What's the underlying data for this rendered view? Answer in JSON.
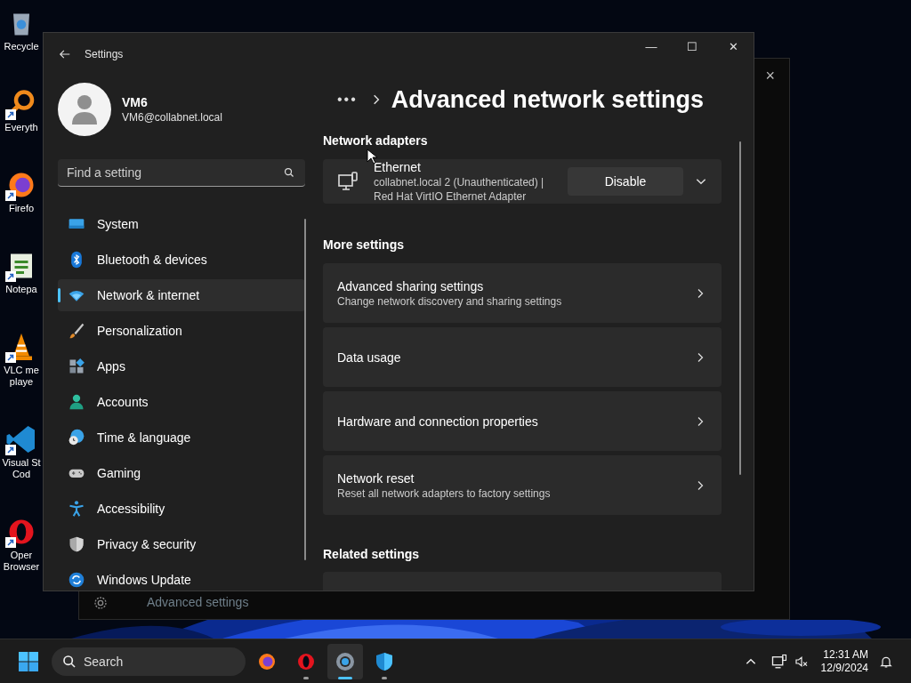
{
  "desktop_icons": [
    {
      "kind": "bin",
      "lines": [
        "Recycle"
      ],
      "shortcut": false
    },
    {
      "kind": "magnifier",
      "lines": [
        "Everyth"
      ],
      "shortcut": true
    },
    {
      "kind": "firefox",
      "lines": [
        "Firefo"
      ],
      "shortcut": true
    },
    {
      "kind": "notepad",
      "lines": [
        "Notepa"
      ],
      "shortcut": true
    },
    {
      "kind": "cone",
      "lines": [
        "VLC me",
        "playe"
      ],
      "shortcut": true
    },
    {
      "kind": "editor",
      "lines": [
        "Visual St",
        "Cod"
      ],
      "shortcut": true
    },
    {
      "kind": "opera",
      "lines": [
        "Oper",
        "Browser"
      ],
      "shortcut": true
    }
  ],
  "background_window": {
    "close": "×",
    "item": "Advanced settings"
  },
  "window": {
    "title": "Settings",
    "controls": [
      "—",
      "☐",
      "✕"
    ]
  },
  "account": {
    "name": "VM6",
    "email": "VM6@collabnet.local"
  },
  "search": {
    "placeholder": "Find a setting"
  },
  "nav": [
    {
      "label": "System",
      "kind": "system",
      "selected": false
    },
    {
      "label": "Bluetooth & devices",
      "kind": "bluetooth",
      "selected": false
    },
    {
      "label": "Network & internet",
      "kind": "network",
      "selected": true
    },
    {
      "label": "Personalization",
      "kind": "brush",
      "selected": false
    },
    {
      "label": "Apps",
      "kind": "apps",
      "selected": false
    },
    {
      "label": "Accounts",
      "kind": "person",
      "selected": false
    },
    {
      "label": "Time & language",
      "kind": "globe",
      "selected": false
    },
    {
      "label": "Gaming",
      "kind": "gamepad",
      "selected": false
    },
    {
      "label": "Accessibility",
      "kind": "access",
      "selected": false
    },
    {
      "label": "Privacy & security",
      "kind": "shield",
      "selected": false
    },
    {
      "label": "Windows Update",
      "kind": "update",
      "selected": false
    }
  ],
  "header": {
    "breadcrumb": "•••",
    "title": "Advanced network settings"
  },
  "adapters": {
    "heading": "Network adapters",
    "items": [
      {
        "name": "Ethernet",
        "detail_lines": [
          "collabnet.local 2 (Unauthenticated) |",
          "Red Hat VirtIO Ethernet Adapter"
        ],
        "button": "Disable",
        "expanded": false
      }
    ]
  },
  "more_settings": {
    "heading": "More settings",
    "items": [
      {
        "title": "Advanced sharing settings",
        "subtitle": "Change network discovery and sharing settings"
      },
      {
        "title": "Data usage"
      },
      {
        "title": "Hardware and connection properties"
      },
      {
        "title": "Network reset",
        "subtitle": "Reset all network adapters to factory settings"
      }
    ]
  },
  "related_settings": {
    "heading": "Related settings"
  },
  "taskbar": {
    "search_placeholder": "Search",
    "apps": [
      {
        "kind": "firefox",
        "running": false,
        "selected": false
      },
      {
        "kind": "opera",
        "running": true,
        "selected": false
      },
      {
        "kind": "settings",
        "running": true,
        "selected": true
      },
      {
        "kind": "defender",
        "running": true,
        "selected": false
      }
    ],
    "time": "12:31 AM",
    "date": "12/9/2024"
  }
}
